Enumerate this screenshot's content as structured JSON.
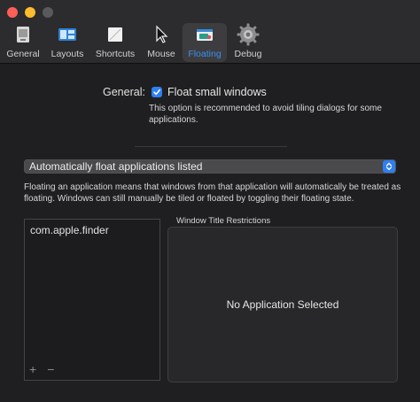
{
  "toolbar": {
    "tabs": [
      {
        "label": "General",
        "icon": "general-pref-icon"
      },
      {
        "label": "Layouts",
        "icon": "layouts-icon"
      },
      {
        "label": "Shortcuts",
        "icon": "shortcuts-icon"
      },
      {
        "label": "Mouse",
        "icon": "mouse-cursor-icon"
      },
      {
        "label": "Floating",
        "icon": "floating-icon",
        "selected": true
      },
      {
        "label": "Debug",
        "icon": "gear-icon"
      }
    ],
    "accent": "#3b8ff0"
  },
  "general": {
    "label": "General:",
    "checkbox_label": "Float small windows",
    "checked": true,
    "hint": "This option is recommended to avoid tiling dialogs for some applications."
  },
  "popup": {
    "value": "Automatically float applications listed"
  },
  "description": "Floating an application means that windows from that application will automatically be treated as floating. Windows can still manually be tiled or floated by toggling their floating state.",
  "applications": {
    "items": [
      "com.apple.finder"
    ],
    "add": "+",
    "remove": "−"
  },
  "restrictions": {
    "title": "Window Title Restrictions",
    "empty_text": "No Application Selected"
  }
}
